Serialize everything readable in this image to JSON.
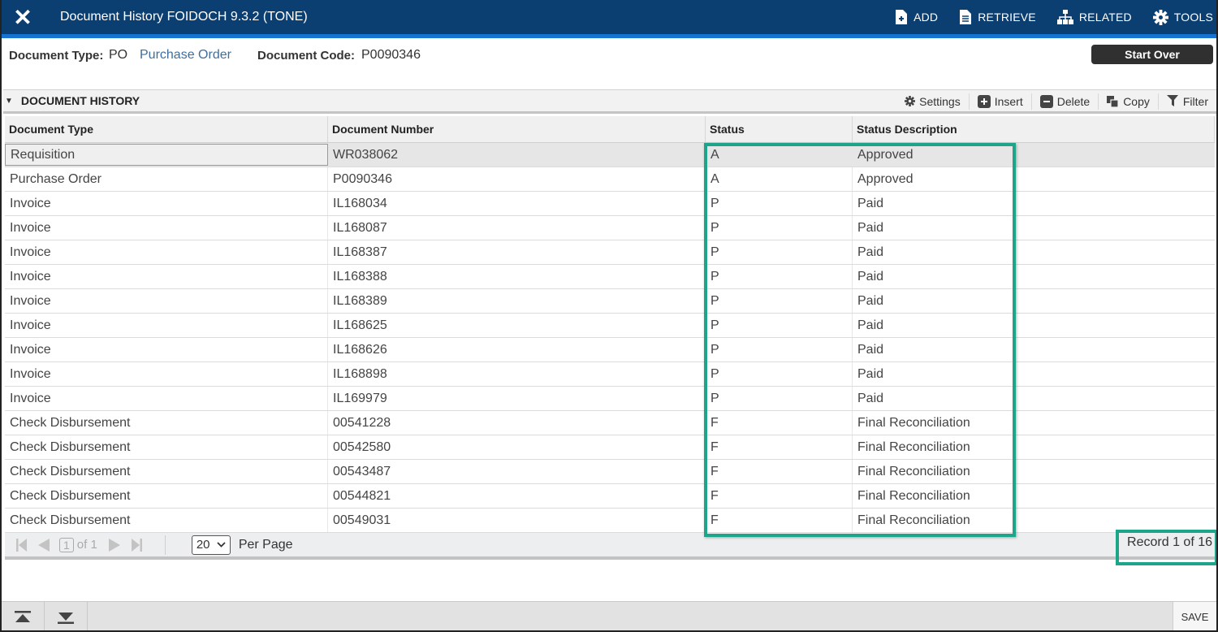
{
  "header": {
    "title": "Document History FOIDOCH 9.3.2 (TONE)",
    "actions": [
      {
        "label": "ADD",
        "icon": "add-document-icon"
      },
      {
        "label": "RETRIEVE",
        "icon": "retrieve-document-icon"
      },
      {
        "label": "RELATED",
        "icon": "related-sitemap-icon"
      },
      {
        "label": "TOOLS",
        "icon": "gear-icon"
      }
    ]
  },
  "keyblock": {
    "doc_type_label": "Document Type:",
    "doc_type_code": "PO",
    "doc_type_desc": "Purchase Order",
    "doc_code_label": "Document Code:",
    "doc_code_value": "P0090346",
    "start_over_label": "Start Over"
  },
  "section": {
    "title": "DOCUMENT HISTORY",
    "tools": [
      {
        "label": "Settings",
        "icon": "gear-icon"
      },
      {
        "label": "Insert",
        "icon": "plus-icon"
      },
      {
        "label": "Delete",
        "icon": "minus-icon"
      },
      {
        "label": "Copy",
        "icon": "copy-icon"
      },
      {
        "label": "Filter",
        "icon": "filter-icon"
      }
    ]
  },
  "grid": {
    "columns": [
      "Document Type",
      "Document Number",
      "Status",
      "Status Description"
    ],
    "rows": [
      [
        "Requisition",
        "WR038062",
        "A",
        "Approved"
      ],
      [
        "Purchase Order",
        "P0090346",
        "A",
        "Approved"
      ],
      [
        "Invoice",
        "IL168034",
        "P",
        "Paid"
      ],
      [
        "Invoice",
        "IL168087",
        "P",
        "Paid"
      ],
      [
        "Invoice",
        "IL168387",
        "P",
        "Paid"
      ],
      [
        "Invoice",
        "IL168388",
        "P",
        "Paid"
      ],
      [
        "Invoice",
        "IL168389",
        "P",
        "Paid"
      ],
      [
        "Invoice",
        "IL168625",
        "P",
        "Paid"
      ],
      [
        "Invoice",
        "IL168626",
        "P",
        "Paid"
      ],
      [
        "Invoice",
        "IL168898",
        "P",
        "Paid"
      ],
      [
        "Invoice",
        "IL169979",
        "P",
        "Paid"
      ],
      [
        "Check Disbursement",
        "00541228",
        "F",
        "Final Reconciliation"
      ],
      [
        "Check Disbursement",
        "00542580",
        "F",
        "Final Reconciliation"
      ],
      [
        "Check Disbursement",
        "00543487",
        "F",
        "Final Reconciliation"
      ],
      [
        "Check Disbursement",
        "00544821",
        "F",
        "Final Reconciliation"
      ],
      [
        "Check Disbursement",
        "00549031",
        "F",
        "Final Reconciliation"
      ]
    ]
  },
  "pager": {
    "current_page": "1",
    "of_pages": "of 1",
    "per_page_value": "20",
    "per_page_label": "Per Page",
    "record_text": "Record 1 of 16"
  },
  "footer": {
    "save_label": "SAVE"
  },
  "colors": {
    "header_bg": "#0b3e71",
    "accent_strip": "#1573d4",
    "highlight": "#1ca58a"
  }
}
